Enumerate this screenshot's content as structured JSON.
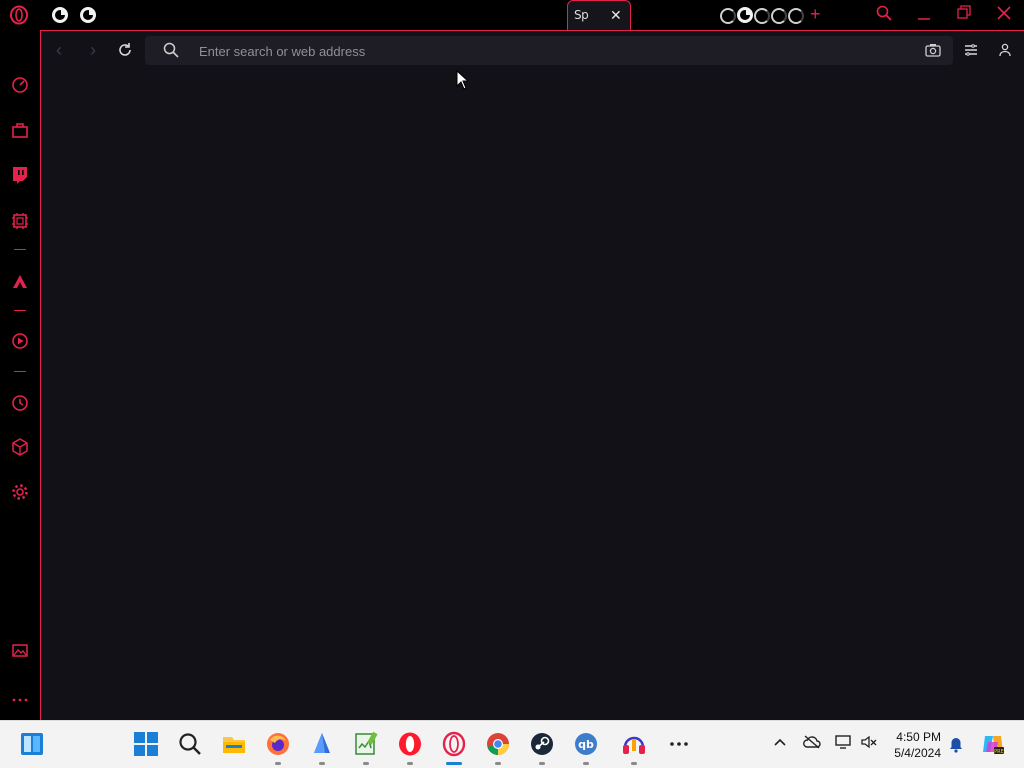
{
  "browser": {
    "accent_color": "#e5224c",
    "tabs": {
      "tab_group_1_text": "ᅠᅠᅠᅠᅠᅠᅠᅠᅠᅠᅠᅠᅠᅠᅠᅠᅠᅠᅠᅠᅠᅠᅠᅠᅠᅠᅠᅠᅠᅠᅠᅠᅠᅠ",
      "active_tab_label": "Sp",
      "tab_group_2_text": "ᅠᅠᅠᅠᅠ"
    },
    "address_bar": {
      "placeholder": "Enter search or web address",
      "value": ""
    }
  },
  "sidebar": {
    "items": [
      "speed-dial-icon",
      "bag-icon",
      "twitch-icon",
      "cpu-icon",
      "aria-icon",
      "player-icon",
      "history-icon",
      "extensions-icon",
      "settings-icon",
      "gallery-icon",
      "more-icon"
    ]
  },
  "taskbar": {
    "time": "4:50 PM",
    "date": "5/4/2024",
    "apps": [
      "start-icon",
      "search-icon",
      "file-explorer-icon",
      "firefox-icon",
      "app-icon",
      "notepad-icon",
      "opera-icon",
      "opera-gx-icon",
      "chrome-icon",
      "steam-icon",
      "qbittorrent-icon",
      "headphones-app-icon",
      "more-apps-icon"
    ]
  }
}
